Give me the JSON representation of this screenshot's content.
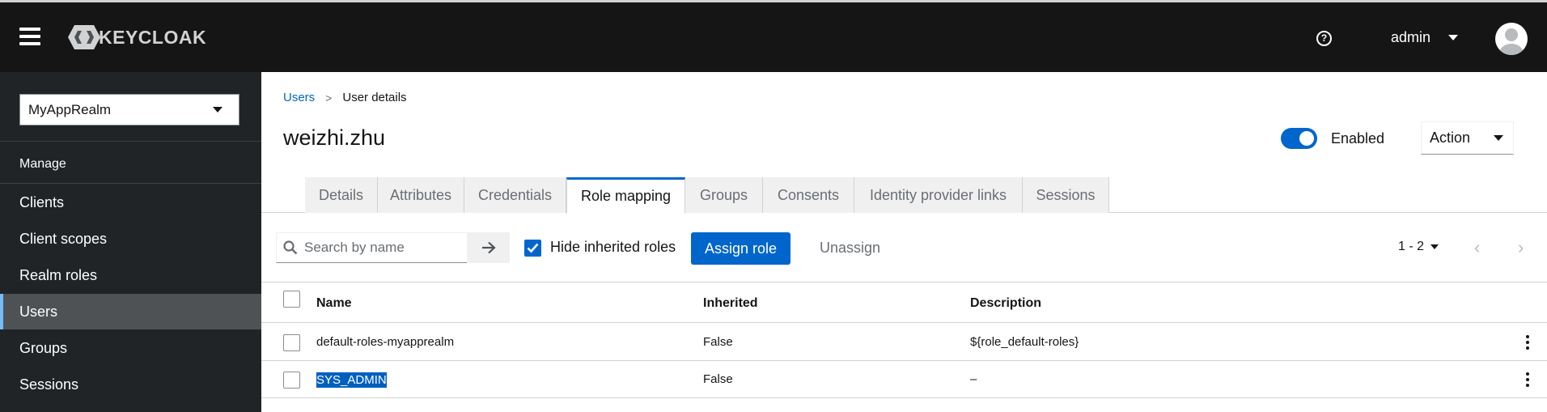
{
  "header": {
    "logo_text": "KEYCLOAK",
    "user_name": "admin",
    "help_glyph": "?"
  },
  "sidebar": {
    "realm": "MyAppRealm",
    "section_label": "Manage",
    "items": [
      {
        "label": "Clients"
      },
      {
        "label": "Client scopes"
      },
      {
        "label": "Realm roles"
      },
      {
        "label": "Users",
        "active": true
      },
      {
        "label": "Groups"
      },
      {
        "label": "Sessions"
      }
    ]
  },
  "breadcrumb": {
    "root": "Users",
    "separator": ">",
    "current": "User details"
  },
  "page": {
    "title": "weizhi.zhu",
    "enabled_label": "Enabled",
    "enabled": true,
    "action_label": "Action"
  },
  "tabs": [
    {
      "label": "Details"
    },
    {
      "label": "Attributes"
    },
    {
      "label": "Credentials"
    },
    {
      "label": "Role mapping",
      "active": true
    },
    {
      "label": "Groups"
    },
    {
      "label": "Consents"
    },
    {
      "label": "Identity provider links"
    },
    {
      "label": "Sessions"
    }
  ],
  "toolbar": {
    "search_placeholder": "Search by name",
    "hide_inherited_label": "Hide inherited roles",
    "hide_inherited_checked": true,
    "assign_label": "Assign role",
    "unassign_label": "Unassign",
    "pagination": "1 - 2",
    "prev_glyph": "‹",
    "next_glyph": "›"
  },
  "table": {
    "columns": [
      "Name",
      "Inherited",
      "Description"
    ],
    "rows": [
      {
        "name": "default-roles-myapprealm",
        "inherited": "False",
        "description": "${role_default-roles}"
      },
      {
        "name": "SYS_ADMIN",
        "inherited": "False",
        "description": "–"
      }
    ]
  },
  "colors": {
    "accent": "#0066cc",
    "topbar": "#151515",
    "sidebar": "#212427",
    "sidebar_active": "#4f5255"
  }
}
